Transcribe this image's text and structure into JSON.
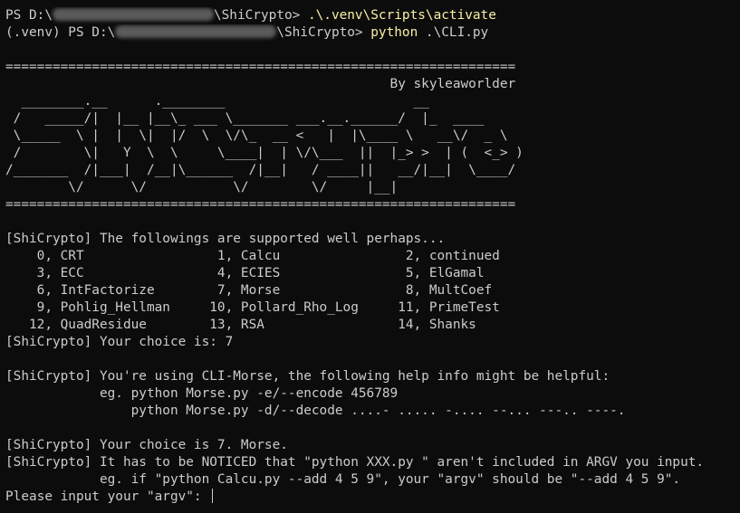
{
  "colors": {
    "background": "#0c0c0c",
    "text": "#cccccc",
    "command_highlight": "#f9f1a5"
  },
  "prompt1": {
    "prefix": "PS D:\\",
    "suffix": "\\ShiCrypto> ",
    "command": ".\\.venv\\Scripts\\activate"
  },
  "prompt2": {
    "prefix": "(.venv) PS D:\\",
    "suffix": "\\ShiCrypto> ",
    "command_exec": "python",
    "command_args": " .\\CLI.py"
  },
  "separator": "=================================================================",
  "byline": "                                                 By skyleaworlder",
  "banner": [
    "  ________.__      .________                        __           ",
    " /   _____/|  |__ |__\\_ ___ \\_______ ___.__.______/  |_  ____   ",
    " \\_____  \\ |  |  \\|  |/  \\  \\/\\_  __ <   |  |\\____ \\   __\\/  _ \\  ",
    " /        \\|   Y  \\  \\     \\____|  | \\/\\___  ||  |_> >  | (  <_> ) ",
    "/_______  /|___|  /__|\\______  /|__|   / ____||   __/|__|  \\____/  ",
    "        \\/      \\/           \\/        \\/     |__|                 "
  ],
  "supported_header": "[ShiCrypto] The followings are supported well perhaps...",
  "modules": [
    "    0, CRT                 1, Calcu                2, continued",
    "    3, ECC                 4, ECIES                5, ElGamal",
    "    6, IntFactorize        7, Morse                8, MultCoef",
    "    9, Pohlig_Hellman     10, Pollard_Rho_Log     11, PrimeTest",
    "   12, QuadResidue        13, RSA                 14, Shanks"
  ],
  "choice_line": "[ShiCrypto] Your choice is: 7",
  "help": {
    "intro": "[ShiCrypto] You're using CLI-Morse, the following help info might be helpful:",
    "example1": "            eg. python Morse.py -e/--encode 456789",
    "example2": "                python Morse.py -d/--decode ....- ..... -.... --... ---.. ----."
  },
  "confirm_line": "[ShiCrypto] Your choice is 7. Morse.",
  "notice_line1": "[ShiCrypto] It has to be NOTICED that \"python XXX.py \" aren't included in ARGV you input.",
  "notice_line2": "            eg. if \"python Calcu.py --add 4 5 9\", your \"argv\" should be \"--add 4 5 9\".",
  "input_prompt": "Please input your \"argv\": "
}
